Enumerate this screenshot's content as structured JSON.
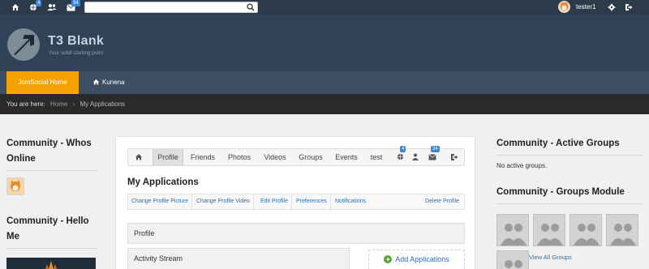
{
  "topbar": {
    "icons": [
      "home-icon",
      "globe-icon",
      "users-icon",
      "mail-icon"
    ],
    "notification_badge": "4",
    "message_badge": "34",
    "search": {
      "placeholder": "",
      "value": ""
    },
    "username": "tester1"
  },
  "header": {
    "site_name": "T3 Blank",
    "tagline": "Your solid starting point"
  },
  "nav": {
    "items": [
      {
        "label": "JomSocial Home",
        "active": true
      },
      {
        "label": "Kunena",
        "active": false,
        "icon": "home-icon"
      }
    ]
  },
  "breadcrumb": {
    "prefix": "You are here:",
    "items": [
      "Home",
      "My Applications"
    ],
    "separator": "›"
  },
  "left": {
    "whos_online_title": "Community - Whos Online",
    "hello_title": "Community - Hello Me"
  },
  "main": {
    "tabs": [
      {
        "label": "",
        "icon": "home-icon"
      },
      {
        "label": "Profile",
        "active": true
      },
      {
        "label": "Friends"
      },
      {
        "label": "Photos"
      },
      {
        "label": "Videos"
      },
      {
        "label": "Groups"
      },
      {
        "label": "Events"
      },
      {
        "label": "test"
      }
    ],
    "tab_icons": [
      "globe-icon",
      "user-icon",
      "mail-icon",
      "logout-icon"
    ],
    "tab_notification_badge": "4",
    "tab_message_badge": "34",
    "title": "My Applications",
    "actions": [
      "Change Profile Picture",
      "Change Profile Video",
      "Edit Profile",
      "Preferences",
      "Notifications"
    ],
    "delete_action": "Delete Profile",
    "section_profile": "Profile",
    "section_stream": "Activity Stream",
    "add_apps": "Add Applications"
  },
  "right": {
    "active_groups_title": "Community - Active Groups",
    "no_groups": "No active groups.",
    "groups_module_title": "Community - Groups Module",
    "view_all": "View All Groups"
  },
  "colors": {
    "topbar": "#2d3a4a",
    "header": "#2f4257",
    "nav": "#3b4e63",
    "nav_active": "#f4a300",
    "link": "#2a6fb0",
    "badge": "#3a86d4"
  }
}
